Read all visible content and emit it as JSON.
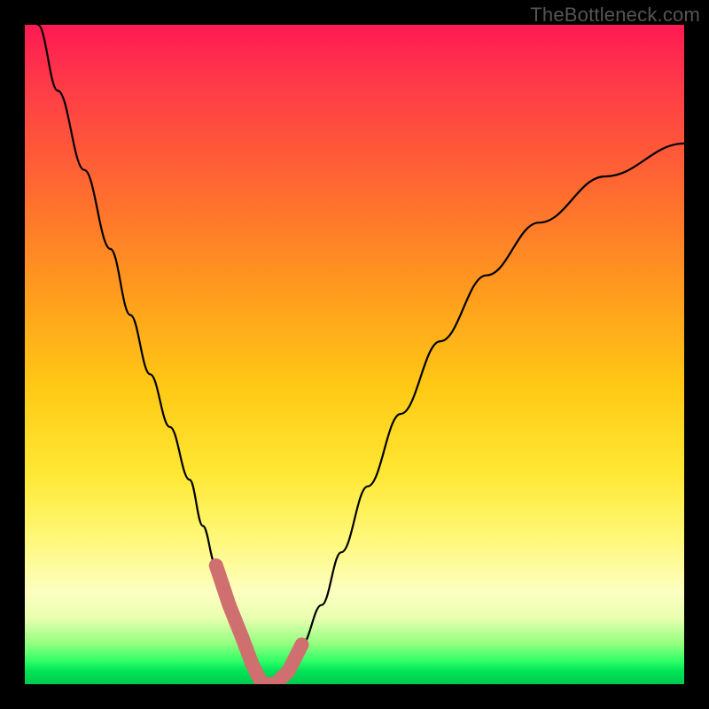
{
  "watermark": "TheBottleneck.com",
  "colors": {
    "frame": "#000000",
    "curve": "#000000",
    "marks": "#cf6f6f",
    "gradient_top": "#ff1a53",
    "gradient_mid": "#ffe833",
    "gradient_bottom": "#00c94e"
  },
  "chart_data": {
    "type": "line",
    "title": "",
    "xlabel": "",
    "ylabel": "",
    "xlim": [
      0,
      100
    ],
    "ylim": [
      0,
      100
    ],
    "series": [
      {
        "name": "bottleneck-curve",
        "x": [
          2,
          5,
          9,
          13,
          16,
          19,
          22,
          25,
          27,
          29,
          31,
          33,
          34.5,
          36,
          38,
          40,
          42,
          45,
          48,
          52,
          57,
          63,
          70,
          78,
          88,
          100
        ],
        "values": [
          100,
          90,
          78,
          66,
          56,
          47,
          39,
          31,
          24,
          18,
          12,
          7,
          3,
          0,
          0,
          2,
          6,
          12,
          20,
          30,
          41,
          52,
          62,
          70,
          77,
          82
        ]
      }
    ],
    "highlight_segments": [
      {
        "x": [
          29,
          31,
          33,
          34.5
        ],
        "values": [
          18,
          12,
          7,
          3
        ]
      },
      {
        "x": [
          34.5,
          36,
          38,
          40,
          42
        ],
        "values": [
          3,
          0,
          0,
          2,
          6
        ]
      }
    ]
  }
}
